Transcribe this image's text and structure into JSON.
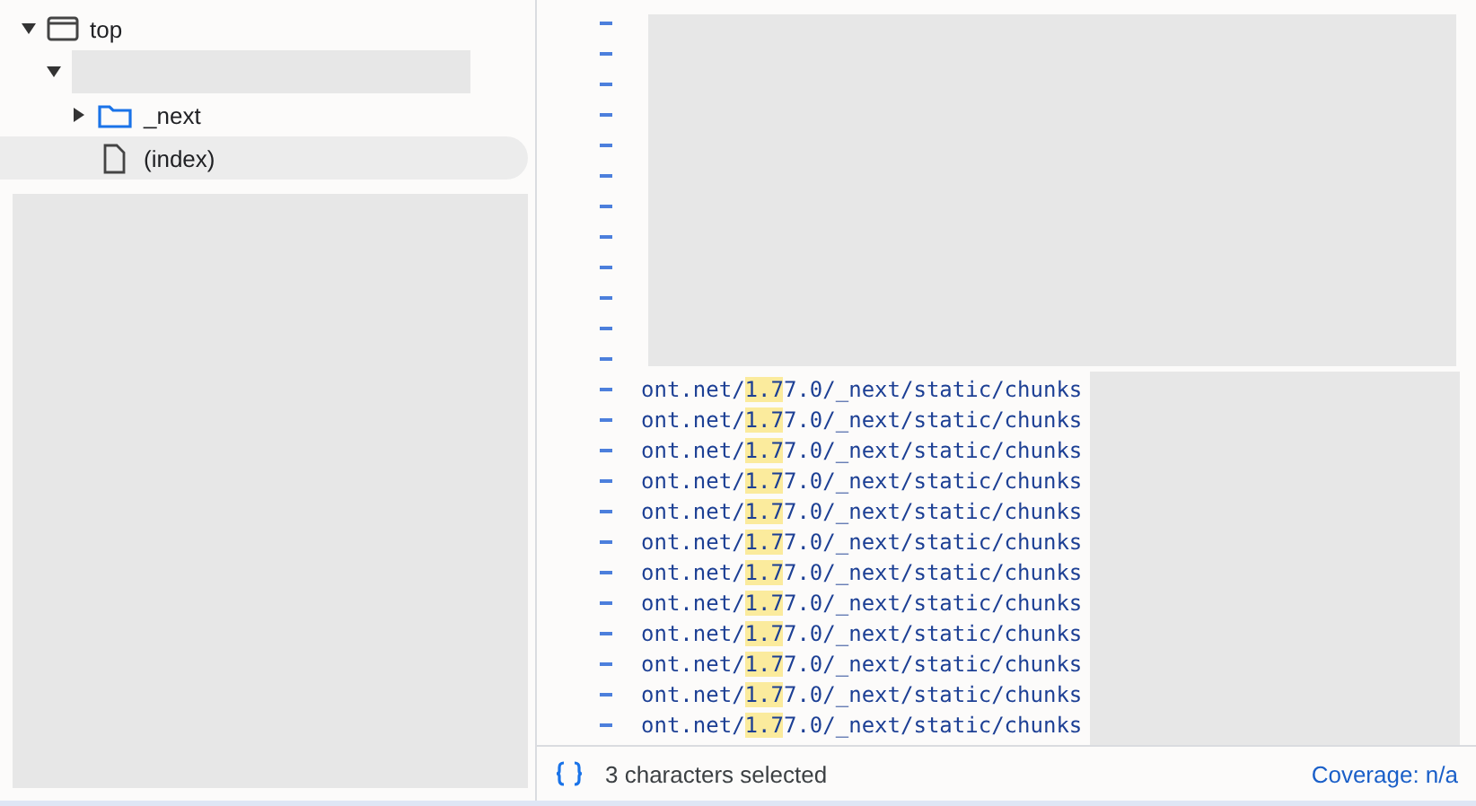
{
  "tree": {
    "label": "top",
    "expanded": true,
    "children": [
      {
        "label_hidden": true,
        "expanded": true,
        "children": [
          {
            "label": "_next",
            "kind": "folder",
            "expanded": false,
            "selected": false
          },
          {
            "label": "(index)",
            "kind": "file",
            "selected": true
          }
        ]
      }
    ]
  },
  "code_lines": [
    {
      "before": "ont.net/",
      "match": "1.7",
      "after": "7.0/_next/static/chunks"
    },
    {
      "before": "ont.net/",
      "match": "1.7",
      "after": "7.0/_next/static/chunks"
    },
    {
      "before": "ont.net/",
      "match": "1.7",
      "after": "7.0/_next/static/chunks"
    },
    {
      "before": "ont.net/",
      "match": "1.7",
      "after": "7.0/_next/static/chunks"
    },
    {
      "before": "ont.net/",
      "match": "1.7",
      "after": "7.0/_next/static/chunks"
    },
    {
      "before": "ont.net/",
      "match": "1.7",
      "after": "7.0/_next/static/chunks"
    },
    {
      "before": "ont.net/",
      "match": "1.7",
      "after": "7.0/_next/static/chunks"
    },
    {
      "before": "ont.net/",
      "match": "1.7",
      "after": "7.0/_next/static/chunks"
    },
    {
      "before": "ont.net/",
      "match": "1.7",
      "after": "7.0/_next/static/chunks"
    },
    {
      "before": "ont.net/",
      "match": "1.7",
      "after": "7.0/_next/static/chunks"
    },
    {
      "before": "ont.net/",
      "match": "1.7",
      "after": "7.0/_next/static/chunks"
    },
    {
      "before": "ont.net/",
      "match": "1.7",
      "after": "7.0/_next/static/chunks"
    }
  ],
  "status_bar": {
    "selection": "3 characters selected",
    "coverage": "Coverage: n/a"
  }
}
